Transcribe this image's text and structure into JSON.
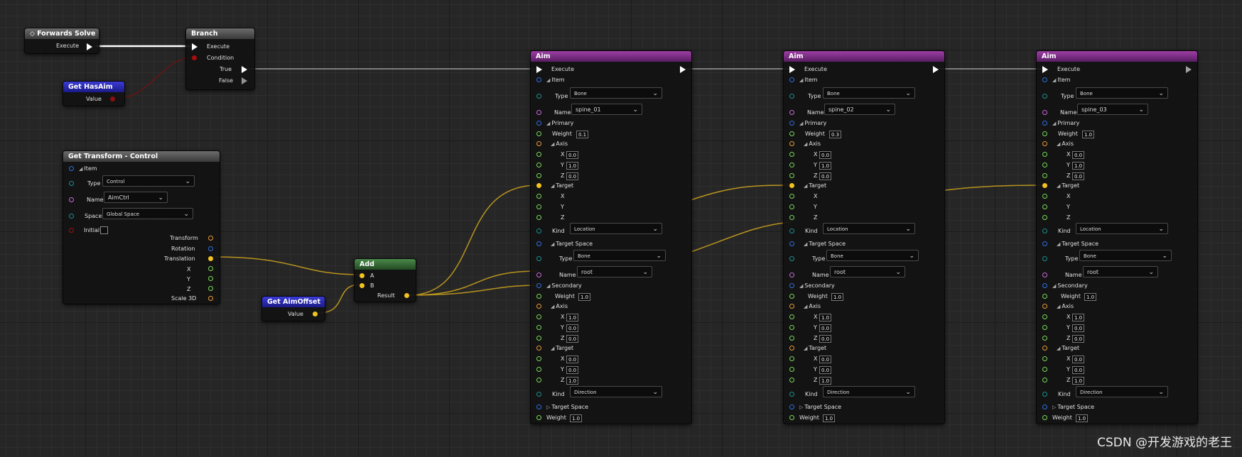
{
  "colors": {
    "canvas": "#262626",
    "wire_exec": "#ffffff",
    "wire_vector": "#d8b02a",
    "wire_bool": "#8b1010",
    "aim_header": "#7a2e85",
    "get_header": "#2a2ab0",
    "add_header": "#3a6e3a"
  },
  "forwards_solve": {
    "title": "Forwards Solve",
    "execute": "Execute"
  },
  "branch": {
    "title": "Branch",
    "execute": "Execute",
    "condition": "Condition",
    "true": "True",
    "false": "False"
  },
  "get_has_aim": {
    "title": "Get HasAim",
    "value": "Value"
  },
  "get_transform": {
    "title": "Get Transform - Control",
    "item": "Item",
    "type_label": "Type",
    "type_value": "Control",
    "name_label": "Name",
    "name_value": "AimCtrl",
    "space_label": "Space",
    "space_value": "Global Space",
    "initial": "Initial",
    "transform": "Transform",
    "rotation": "Rotation",
    "translation": "Translation",
    "x": "X",
    "y": "Y",
    "z": "Z",
    "scale": "Scale 3D"
  },
  "get_aim_offset": {
    "title": "Get AimOffset",
    "value": "Value"
  },
  "add": {
    "title": "Add",
    "a": "A",
    "b": "B",
    "result": "Result"
  },
  "aim_labels": {
    "title": "Aim",
    "execute": "Execute",
    "item": "Item",
    "type": "Type",
    "name": "Name",
    "primary": "Primary",
    "weight": "Weight",
    "axis": "Axis",
    "x": "X",
    "y": "Y",
    "z": "Z",
    "target": "Target",
    "kind": "Kind",
    "target_space": "Target Space",
    "secondary": "Secondary"
  },
  "aims": [
    {
      "type_value": "Bone",
      "name_value": "spine_01",
      "p_weight": "0.1",
      "p_axis": [
        "0.0",
        "1.0",
        "0.0"
      ],
      "kind": "Location",
      "ts_type": "Bone",
      "ts_name": "root",
      "s_weight": "1.0",
      "s_axis": [
        "1.0",
        "0.0",
        "0.0"
      ],
      "s_target": [
        "0.0",
        "0.0",
        "1.0"
      ],
      "s_kind": "Direction",
      "weight": "1.0"
    },
    {
      "type_value": "Bone",
      "name_value": "spine_02",
      "p_weight": "0.3",
      "p_axis": [
        "0.0",
        "1.0",
        "0.0"
      ],
      "kind": "Location",
      "ts_type": "Bone",
      "ts_name": "root",
      "s_weight": "1.0",
      "s_axis": [
        "1.0",
        "0.0",
        "0.0"
      ],
      "s_target": [
        "0.0",
        "0.0",
        "1.0"
      ],
      "s_kind": "Direction",
      "weight": "1.0"
    },
    {
      "type_value": "Bone",
      "name_value": "spine_03",
      "p_weight": "1.0",
      "p_axis": [
        "0.0",
        "1.0",
        "0.0"
      ],
      "kind": "Location",
      "ts_type": "Bone",
      "ts_name": "root",
      "s_weight": "1.0",
      "s_axis": [
        "1.0",
        "0.0",
        "0.0"
      ],
      "s_target": [
        "0.0",
        "0.0",
        "1.0"
      ],
      "s_kind": "Direction",
      "weight": "1.0"
    }
  ],
  "watermark": "CSDN @开发游戏的老王"
}
